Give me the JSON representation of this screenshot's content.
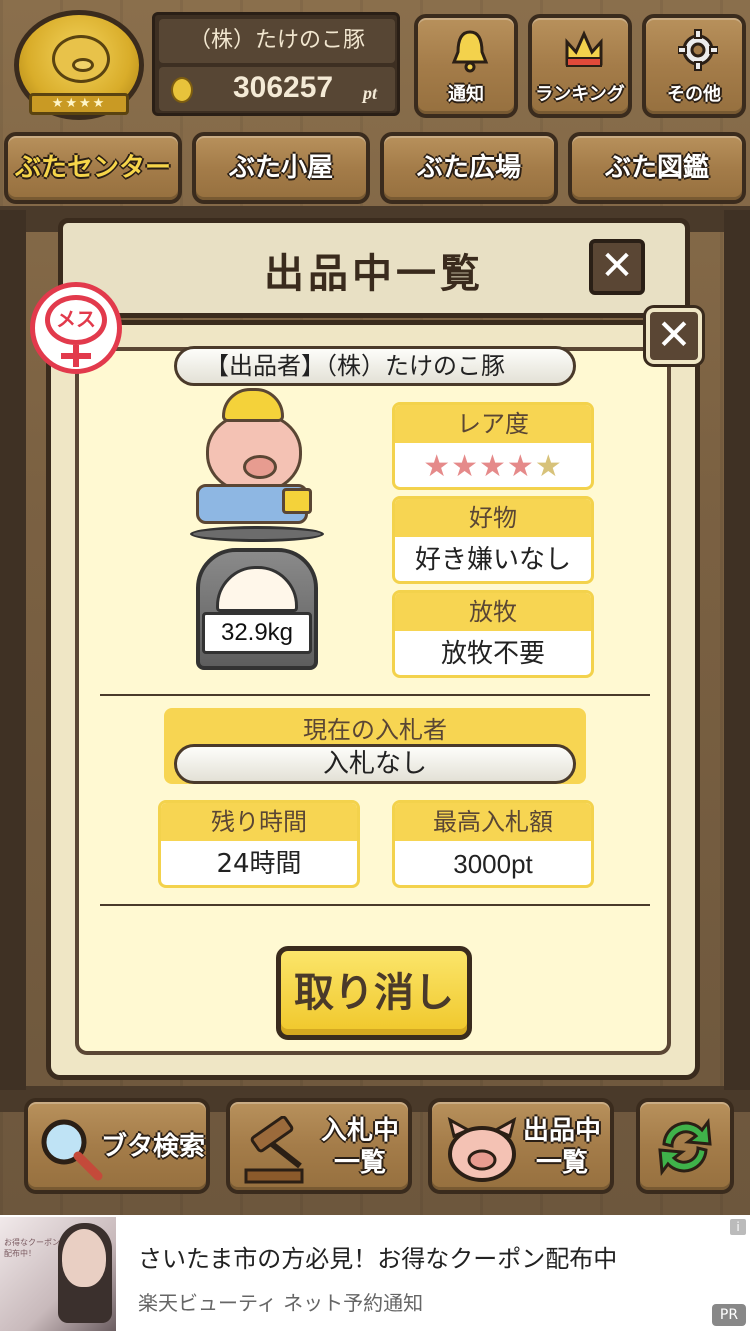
{
  "header": {
    "medal_ribbon": "★★★★",
    "user_name": "（株）たけのこ豚",
    "points": "306257",
    "points_unit": "pt",
    "buttons": [
      {
        "label": "通知",
        "icon": "bell-icon"
      },
      {
        "label": "ランキング",
        "icon": "crown-icon"
      },
      {
        "label": "その他",
        "icon": "gear-icon"
      }
    ]
  },
  "tabs": [
    {
      "label": "ぶたセンター",
      "active": true
    },
    {
      "label": "ぶた小屋",
      "active": false
    },
    {
      "label": "ぶた広場",
      "active": false
    },
    {
      "label": "ぶた図鑑",
      "active": false
    }
  ],
  "back_panel": {
    "title": "出品中一覧",
    "close": "✕"
  },
  "modal": {
    "close": "✕",
    "gender_badge": "メス",
    "seller": "【出品者】（株）たけのこ豚",
    "weight": "32.9kg",
    "rarity": {
      "label": "レア度",
      "stars_filled": 4,
      "stars_total": 5,
      "filled_glyphs": "★★★★",
      "empty_glyphs": "★"
    },
    "favorite": {
      "label": "好物",
      "value": "好き嫌いなし"
    },
    "grazing": {
      "label": "放牧",
      "value": "放牧不要"
    },
    "current_bidder": {
      "label": "現在の入札者",
      "value": "入札なし"
    },
    "remaining_time": {
      "label": "残り時間",
      "value": "24時間"
    },
    "highest_bid": {
      "label": "最高入札額",
      "value": "3000pt"
    },
    "cancel_button": "取り消し"
  },
  "toolbar": {
    "search": "ブタ検索",
    "bidding_line1": "入札中",
    "bidding_line2": "一覧",
    "listing_line1": "出品中",
    "listing_line2": "一覧",
    "refresh_icon": "refresh-icon"
  },
  "ad": {
    "title": "さいたま市の方必見！お得なクーポン配布中",
    "subtitle": "楽天ビューティ ネット予約通知",
    "pr": "PR",
    "info": "i",
    "thumb_text": "お得なクーポン配布中！"
  },
  "colors": {
    "accent_yellow": "#f7d552",
    "wood": "#a47c49",
    "dark_brown": "#3a2b1d",
    "star_pink": "#e58a8a",
    "female_red": "#e23a4c"
  }
}
